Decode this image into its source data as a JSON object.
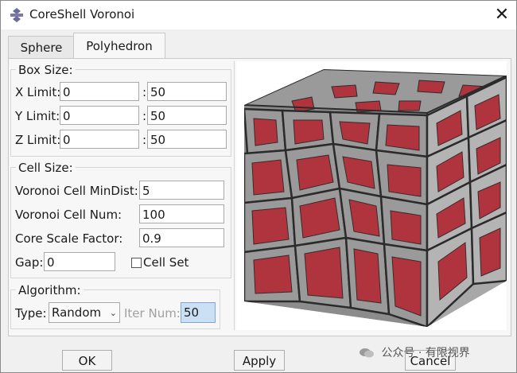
{
  "window": {
    "title": "CoreShell Voronoi",
    "close_glyph": "✕"
  },
  "tabs": [
    {
      "label": "Sphere"
    },
    {
      "label": "Polyhedron",
      "active": true
    }
  ],
  "box_size": {
    "title": "Box Size:",
    "rows": [
      {
        "label": "X Limit:",
        "min": "0",
        "max": "50"
      },
      {
        "label": "Y Limit:",
        "min": "0",
        "max": "50"
      },
      {
        "label": "Z Limit:",
        "min": "0",
        "max": "50"
      }
    ],
    "colon": ":"
  },
  "cell_size": {
    "title": "Cell Size:",
    "min_dist_label": "Voronoi Cell MinDist:",
    "min_dist_value": "5",
    "cell_num_label": "Voronoi Cell Num:",
    "cell_num_value": "100",
    "core_scale_label": "Core Scale Factor:",
    "core_scale_value": "0.9",
    "gap_label": "Gap:",
    "gap_value": "0",
    "cell_set_label": "Cell Set",
    "cell_set_checked": false
  },
  "algorithm": {
    "title": "Algorithm:",
    "type_label": "Type:",
    "type_value": "Random",
    "iter_label": "Iter Num:",
    "iter_value": "50"
  },
  "buttons": {
    "ok": "OK",
    "apply": "Apply",
    "cancel": "Cancel"
  },
  "watermark": "公众号 · 有限视界",
  "icons": {
    "title": "app-gear-icon",
    "preview": "voronoi-cube-preview",
    "wechat": "wechat-icon"
  },
  "colors": {
    "core": "#b0343e",
    "shell": "#8a8a8a",
    "edge": "#2b2b2b",
    "selected_field": "#cce0f5"
  }
}
